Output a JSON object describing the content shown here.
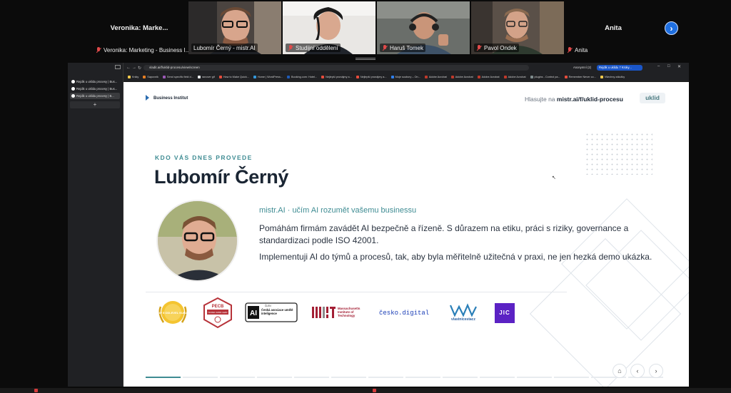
{
  "meeting": {
    "left_participant_name": "Veronika:  Marke...",
    "left_participant_label": "Veronika: Marketing - Business I...",
    "right_participant_name": "Anita",
    "right_participant_label": "Anita",
    "tiles": [
      {
        "label": "Lubomír Černý - mistr.AI",
        "mic": "on"
      },
      {
        "label": "Studijní oddělení",
        "mic": "off"
      },
      {
        "label": "Haruš Tomek",
        "mic": "off"
      },
      {
        "label": "Pavol Ondek",
        "mic": "off"
      }
    ],
    "next_icon": "chevron-right-icon"
  },
  "browser": {
    "url": "vladit.ai/f/uklid-procesu/view/screen",
    "vertical_tabs": [
      "Rejdik u uklidu procesy | Bus...",
      "Rejdik u uklidu procesy | Bus...",
      "Rejdik u uklidu procesy | B..."
    ],
    "add_tab": "+",
    "profile": "Anonymní (2)",
    "active_tab": "Rejdik u uklidu 7 Kroky...",
    "bookmarks": [
      "Kniky",
      "Sapovnik",
      "Send specific field d...",
      "ranover gif",
      "How to Make Quick...",
      "Home | WordPress...",
      "Booking.com: Hotel...",
      "Nejlepší pronájmy a...",
      "Nejlepší pronájmy a...",
      "Moje soubory – On...",
      "Adobe Acrobat",
      "Adobe Acrobat",
      "Adobe Acrobat",
      "Adobe Acrobat",
      "plugins - Control pa...",
      "Remember Never co...",
      "Všechny záložky"
    ]
  },
  "slide": {
    "brand": "Business Institut",
    "hlasujte_prefix": "Hlasujte na",
    "hlasujte_url": "mistr.ai/f/uklid-procesu",
    "hlasujte_badge": "uklid",
    "eyebrow": "KDO VÁS DNES PROVEDE",
    "name": "Lubomír Černý",
    "tagline": "mistr.AI · učím AI rozumět vašemu businessu",
    "paragraph1": "Pomáhám firmám zavádět AI bezpečně a řízeně. S důrazem na etiku, práci s riziky, governance a standardizaci podle ISO 42001.",
    "paragraph2": "Implementuji AI do týmů a procesů, tak, aby byla měřitelně užitečná v praxi, ne jen hezká demo ukázka.",
    "logos": {
      "top_lektor": "TOP 5 ODLEVEL KURZŮ",
      "pecb": "PECB",
      "pecb_sub": "ISO/IEC 42001 LEAD",
      "cau_clen": "ČLEN",
      "cau_name": "Česká asociace umělé inteligence",
      "cau_mark": "AI",
      "mit_name": "Massachusetts Institute of Technology",
      "cesko_digital": "česko.digital",
      "vlastnicestacz": "vlastnicestacz",
      "jic": "JIC"
    },
    "progress_current": 1,
    "progress_total": 14,
    "nav_home_icon": "home-icon",
    "nav_prev_icon": "chevron-left-icon",
    "nav_next_icon": "chevron-right-icon"
  },
  "colors": {
    "accent_teal": "#3f8c93",
    "navy": "#1a2533",
    "active_speaker": "#3ccf77",
    "zoom_blue": "#1f6fe0",
    "muted_red": "#e04a4a"
  }
}
